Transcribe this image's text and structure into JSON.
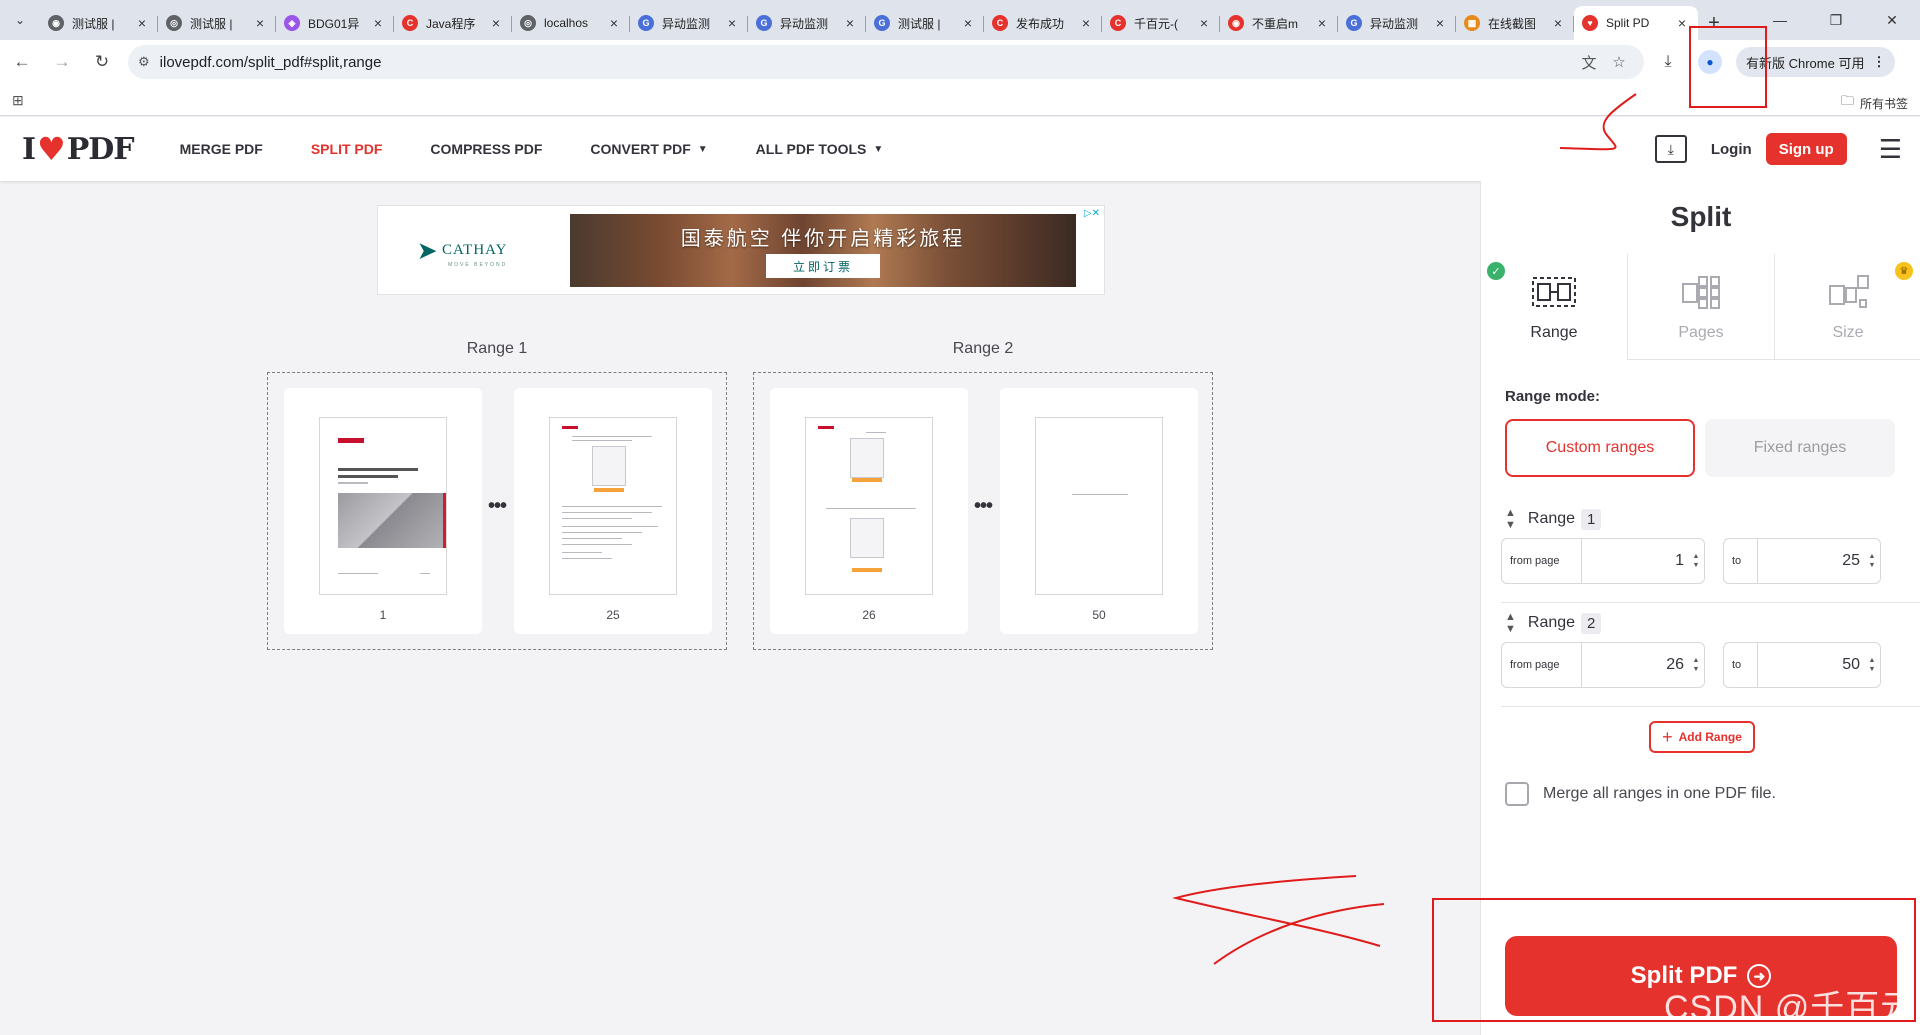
{
  "browser": {
    "tabs": [
      {
        "title": "测试服 |",
        "fav_color": "#5f6368",
        "fav_glyph": "◉"
      },
      {
        "title": "测试服 |",
        "fav_color": "#5f6368",
        "fav_glyph": "◎"
      },
      {
        "title": "BDG01异",
        "fav_color": "#9a56e8",
        "fav_glyph": "◈"
      },
      {
        "title": "Java程序",
        "fav_color": "#e5322d",
        "fav_glyph": "C"
      },
      {
        "title": "localhos",
        "fav_color": "#5f6368",
        "fav_glyph": "◎"
      },
      {
        "title": "异动监测",
        "fav_color": "#4a6fd8",
        "fav_glyph": "G"
      },
      {
        "title": "异动监测",
        "fav_color": "#4a6fd8",
        "fav_glyph": "G"
      },
      {
        "title": "测试服 |",
        "fav_color": "#4a6fd8",
        "fav_glyph": "G"
      },
      {
        "title": "发布成功",
        "fav_color": "#e5322d",
        "fav_glyph": "C"
      },
      {
        "title": "千百元-(",
        "fav_color": "#e5322d",
        "fav_glyph": "C"
      },
      {
        "title": "不重启m",
        "fav_color": "#e5322d",
        "fav_glyph": "◉"
      },
      {
        "title": "异动监测",
        "fav_color": "#4a6fd8",
        "fav_glyph": "G"
      },
      {
        "title": "在线截图",
        "fav_color": "#e88a1a",
        "fav_glyph": "▦"
      },
      {
        "title": "Split PD",
        "fav_color": "#e5322d",
        "fav_glyph": "♥",
        "active": true
      }
    ],
    "new_tab": "+",
    "window_controls": [
      "—",
      "❐",
      "✕"
    ],
    "url": "ilovepdf.com/split_pdf#split,range",
    "update_label": "有新版 Chrome 可用",
    "all_bookmarks": "所有书签"
  },
  "site": {
    "logo_left": "I",
    "logo_right": "PDF",
    "nav": [
      {
        "label": "MERGE PDF",
        "caret": false
      },
      {
        "label": "SPLIT PDF",
        "caret": false,
        "active": true
      },
      {
        "label": "COMPRESS PDF",
        "caret": false
      },
      {
        "label": "CONVERT PDF",
        "caret": true
      },
      {
        "label": "ALL PDF TOOLS",
        "caret": true
      }
    ],
    "login": "Login",
    "signup": "Sign up"
  },
  "ad": {
    "brand": "CATHAY",
    "tagline": "MOVE BEYOND",
    "headline": "国泰航空 伴你开启精彩旅程",
    "cta": "立即订票"
  },
  "ranges_preview": [
    {
      "label": "Range 1",
      "pages": [
        "1",
        "25"
      ]
    },
    {
      "label": "Range 2",
      "pages": [
        "26",
        "50"
      ]
    }
  ],
  "ellipsis": "•••",
  "sidebar": {
    "title": "Split",
    "modes": [
      {
        "label": "Range",
        "active": true
      },
      {
        "label": "Pages",
        "active": false
      },
      {
        "label": "Size",
        "active": false
      }
    ],
    "range_mode_label": "Range mode:",
    "custom_ranges": "Custom ranges",
    "fixed_ranges": "Fixed ranges",
    "range_word": "Range",
    "ranges": [
      {
        "number": "1",
        "from_label": "from page",
        "from": "1",
        "to_label": "to",
        "to": "25"
      },
      {
        "number": "2",
        "from_label": "from page",
        "from": "26",
        "to_label": "to",
        "to": "50"
      }
    ],
    "add_range": "Add Range",
    "merge_label": "Merge all ranges in one PDF file.",
    "split_button": "Split PDF"
  },
  "watermark": "CSDN @千百元",
  "colors": {
    "brand_red": "#e5322d",
    "annotation_red": "#e01b1b"
  }
}
